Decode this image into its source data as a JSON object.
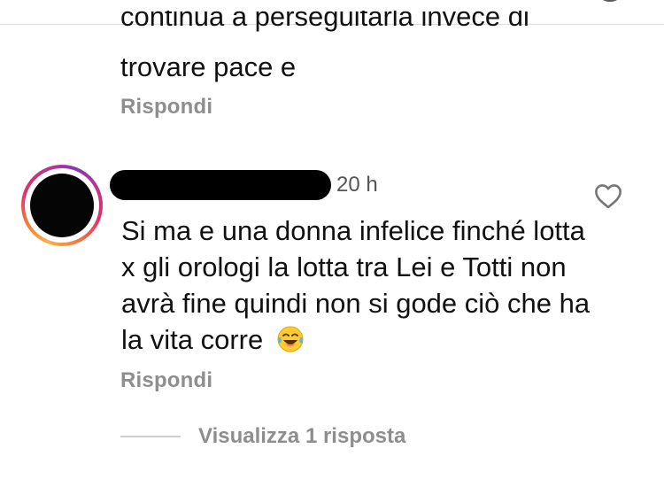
{
  "previous_comment": {
    "partial_line": "continua a perseguitarla invece di",
    "line_2": "trovare pace  e",
    "reply_label": "Rispondi"
  },
  "comment": {
    "timestamp": "20 h",
    "text": "Si ma e una donna infelice finché lotta x gli orologi la lotta tra Lei e Totti non avrà fine quindi non si gode ciò che ha la vita corre",
    "emoji": "laughing-tears-emoji",
    "reply_label": "Rispondi",
    "view_replies_label": "Visualizza 1 risposta"
  },
  "icons": {
    "like": "heart-outline-icon",
    "top_right": "ring-icon"
  },
  "colors": {
    "muted_text": "#8e8e8e",
    "story_ring": [
      "#fcaf45",
      "#f77737",
      "#e1306c",
      "#c13584",
      "#833ab4"
    ]
  }
}
